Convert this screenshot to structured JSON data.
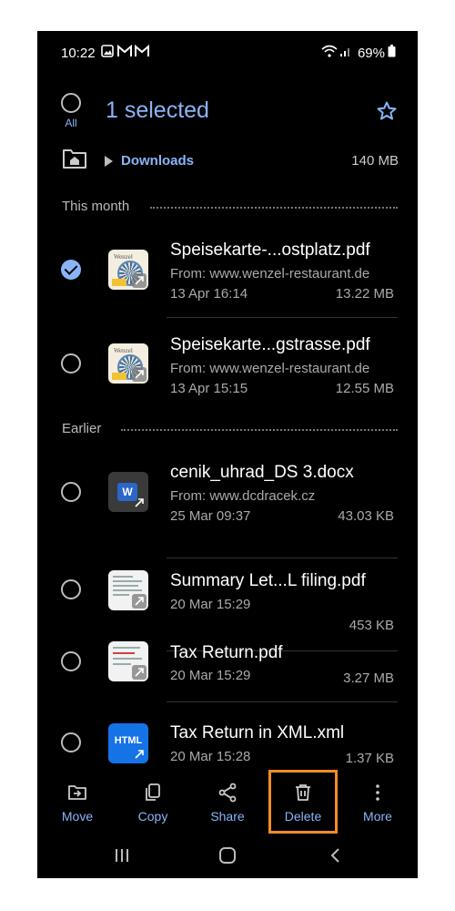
{
  "status_bar": {
    "time": "10:22",
    "battery": "69%"
  },
  "header": {
    "all_label": "All",
    "title": "1 selected"
  },
  "breadcrumb": {
    "folder": "Downloads",
    "size": "140 MB"
  },
  "sections": {
    "this_month": "This month",
    "earlier": "Earlier"
  },
  "files": [
    {
      "name": "Speisekarte-...ostplatz.pdf",
      "from": "From: www.wenzel-restaurant.de",
      "date": "13 Apr 16:14",
      "size": "13.22 MB",
      "selected": true,
      "thumb_brand": "Wenzel"
    },
    {
      "name": "Speisekarte...gstrasse.pdf",
      "from": "From: www.wenzel-restaurant.de",
      "date": "13 Apr 15:15",
      "size": "12.55 MB",
      "selected": false,
      "thumb_brand": "Wenzel"
    },
    {
      "name": "cenik_uhrad_DS 3.docx",
      "from": "From: www.dcdracek.cz",
      "date": "25 Mar 09:37",
      "size": "43.03 KB",
      "selected": false,
      "thumb_letter": "W"
    },
    {
      "name": "Summary Let...L filing.pdf",
      "date": "20 Mar 15:29",
      "size": "453 KB",
      "selected": false
    },
    {
      "name": "Tax Return.pdf",
      "date": "20 Mar 15:29",
      "size": "3.27 MB",
      "selected": false
    },
    {
      "name": "Tax Return in XML.xml",
      "date": "20 Mar 15:28",
      "size": "1.37 KB",
      "selected": false,
      "thumb_label": "HTML"
    }
  ],
  "actions": {
    "move": "Move",
    "copy": "Copy",
    "share": "Share",
    "delete": "Delete",
    "more": "More"
  },
  "colors": {
    "accent": "#8ab4f8",
    "highlight": "#f28c28",
    "background": "#000000"
  }
}
